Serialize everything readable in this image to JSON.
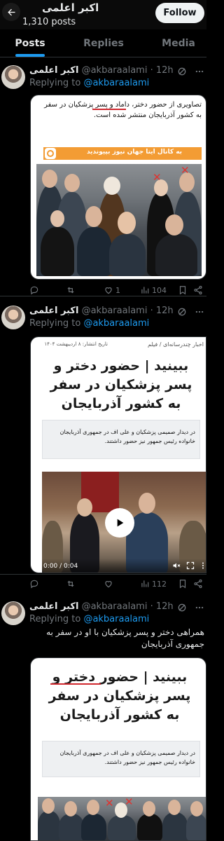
{
  "header": {
    "profile_name": "اکبر اعلمی",
    "post_count": "1,310 posts",
    "follow_label": "Follow"
  },
  "tabs": [
    {
      "label": "Posts",
      "active": true
    },
    {
      "label": "Replies",
      "active": false
    },
    {
      "label": "Media",
      "active": false
    }
  ],
  "posts": [
    {
      "author_name": "اکبر اعلمی",
      "handle": "@akbaraalami",
      "time": "· 12h",
      "replying_prefix": "Replying to",
      "replying_handle": "@akbaraalami",
      "card_text": "تصاویری از حضور دختر، داماد و پسر پزشکیان در سفر به کشور آذربایجان منتشر شده است.",
      "banner_text": "به کانال ایتا جهان نیوز بپیوندید",
      "stats": {
        "likes": "1",
        "views": "104"
      }
    },
    {
      "author_name": "اکبر اعلمی",
      "handle": "@akbaraalami",
      "time": "· 12h",
      "replying_prefix": "Replying to",
      "replying_handle": "@akbaraalami",
      "breadcrumb": "اخبار چندرسانه‌ای / فیلم",
      "date": "تاریخ انتشار: ۸ اردیبهشت ۱۴۰۴",
      "headline": "ببینید | حضور دختر و پسر پزشکیان در سفر به کشور آذربایجان",
      "summary": "در دیدار صمیمی پزشکیان و علی اف در جمهوری آذربایجان خانواده رئیس جمهور نیز حضور داشتند.",
      "video_time": "0:00 / 0:04",
      "stats": {
        "views": "112"
      }
    },
    {
      "author_name": "اکبر اعلمی",
      "handle": "@akbaraalami",
      "time": "· 12h",
      "replying_prefix": "Replying to",
      "replying_handle": "@akbaraalami",
      "body_text": "همراهی دختر و پسر پزشکیان با او در سفر به جمهوری آذربایجان",
      "headline": "ببینید | حضور دختر و پسر پزشکیان در سفر به کشور آذربایجان",
      "summary": "در دیدار صمیمی پزشکیان و علی اف در جمهوری آذربایجان خانواده رئیس جمهور نیز حضور داشتند."
    }
  ],
  "colors": {
    "accent": "#1d9bf0",
    "banner": "#f39c34",
    "underline": "#d0282e"
  }
}
